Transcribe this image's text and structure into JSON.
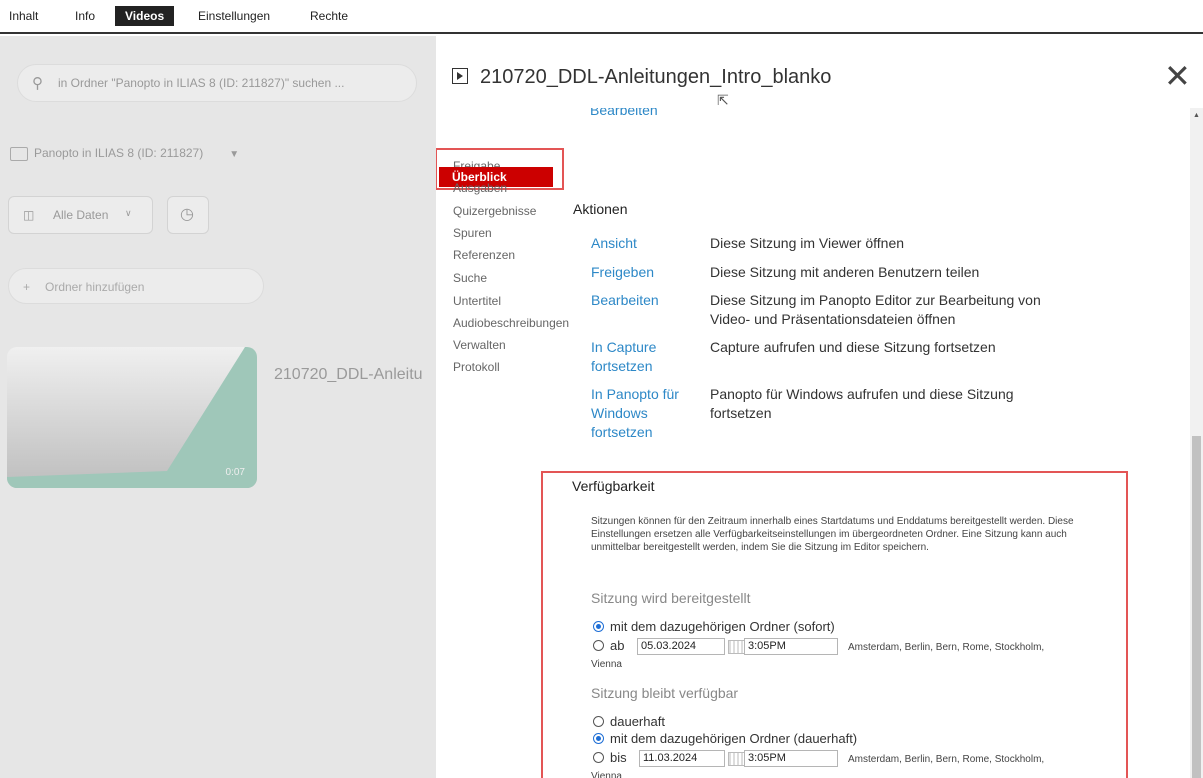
{
  "tabs": [
    {
      "label": "Inhalt",
      "active": false
    },
    {
      "label": "Info",
      "active": false
    },
    {
      "label": "Videos",
      "active": true
    },
    {
      "label": "Einstellungen",
      "active": false
    },
    {
      "label": "Rechte",
      "active": false
    }
  ],
  "background": {
    "search_placeholder": "in Ordner \"Panopto in ILIAS 8 (ID: 211827)\" suchen ...",
    "folder": "Panopto in ILIAS 8 (ID: 211827)",
    "dates_filter": "Alle Daten",
    "add_folder": "Ordner hinzufügen",
    "video_title": "210720_DDL-Anleitu",
    "video_duration": "0:07"
  },
  "modal": {
    "title": "210720_DDL-Anleitungen_Intro_blanko",
    "clipped_link": "Bearbeiten",
    "nav": [
      "Überblick",
      "Freigabe",
      "Ausgaben",
      "Quizergebnisse",
      "Spuren",
      "Referenzen",
      "Suche",
      "Untertitel",
      "Audiobeschreibungen",
      "Verwalten",
      "Protokoll"
    ],
    "actions_title": "Aktionen",
    "actions": [
      {
        "link": "Ansicht",
        "desc": "Diese Sitzung im Viewer öffnen"
      },
      {
        "link": "Freigeben",
        "desc": "Diese Sitzung mit anderen Benutzern teilen"
      },
      {
        "link": "Bearbeiten",
        "desc": "Diese Sitzung im Panopto Editor zur Bearbeitung von Video- und Präsentationsdateien öffnen"
      },
      {
        "link": "In Capture fortsetzen",
        "desc": "Capture aufrufen und diese Sitzung fortsetzen"
      },
      {
        "link": "In Panopto für Windows fortsetzen",
        "desc": "Panopto für Windows aufrufen und diese Sitzung fortsetzen"
      }
    ],
    "availability": {
      "title": "Verfügbarkeit",
      "description": "Sitzungen können für den Zeitraum innerhalb eines Startdatums und Enddatums bereitgestellt werden. Diese Einstellungen ersetzen alle Verfügbarkeitseinstellungen im übergeordneten Ordner. Eine Sitzung kann auch unmittelbar bereitgestellt werden, indem Sie die Sitzung im Editor speichern.",
      "provided_title": "Sitzung wird bereitgestellt",
      "provided_opt1": "mit dem dazugehörigen Ordner (sofort)",
      "provided_opt2": "ab",
      "provided_date": "05.03.2024",
      "provided_time": "3:05PM",
      "timezone_line1": "Amsterdam, Berlin, Bern, Rome, Stockholm,",
      "timezone_line2": "Vienna",
      "remains_title": "Sitzung bleibt verfügbar",
      "remains_opt1": "dauerhaft",
      "remains_opt2": "mit dem dazugehörigen Ordner (dauerhaft)",
      "remains_opt3": "bis",
      "remains_date": "11.03.2024",
      "remains_time": "3:05PM"
    }
  }
}
